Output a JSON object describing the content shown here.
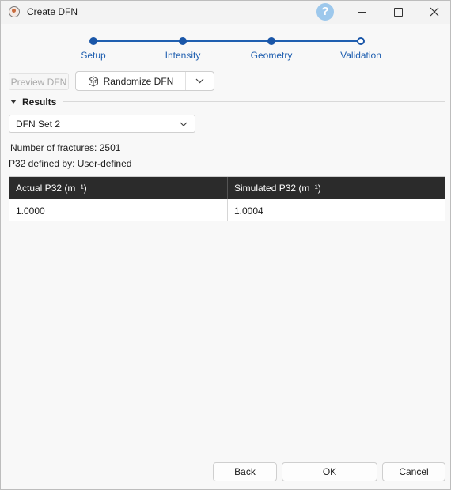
{
  "window": {
    "title": "Create DFN",
    "help_glyph": "?"
  },
  "stepper": {
    "steps": [
      {
        "label": "Setup",
        "state": "complete"
      },
      {
        "label": "Intensity",
        "state": "complete"
      },
      {
        "label": "Geometry",
        "state": "complete"
      },
      {
        "label": "Validation",
        "state": "current"
      }
    ],
    "accent_color": "#1a56a8"
  },
  "toolbar": {
    "preview_label": "Preview DFN",
    "randomize_label": "Randomize DFN",
    "randomize_icon": "cube-icon",
    "dropdown_icon": "chevron-down-icon"
  },
  "results": {
    "section_title": "Results",
    "selected_set": "DFN Set 2",
    "fractures_label": "Number of fractures:",
    "fractures_value": "2501",
    "p32_label": "P32 defined by:",
    "p32_value": "User-defined",
    "table": {
      "headers": [
        "Actual P32 (m⁻¹)",
        "Simulated P32 (m⁻¹)"
      ],
      "rows": [
        [
          "1.0000",
          "1.0004"
        ]
      ]
    }
  },
  "footer": {
    "back_label": "Back",
    "ok_label": "OK",
    "cancel_label": "Cancel"
  }
}
